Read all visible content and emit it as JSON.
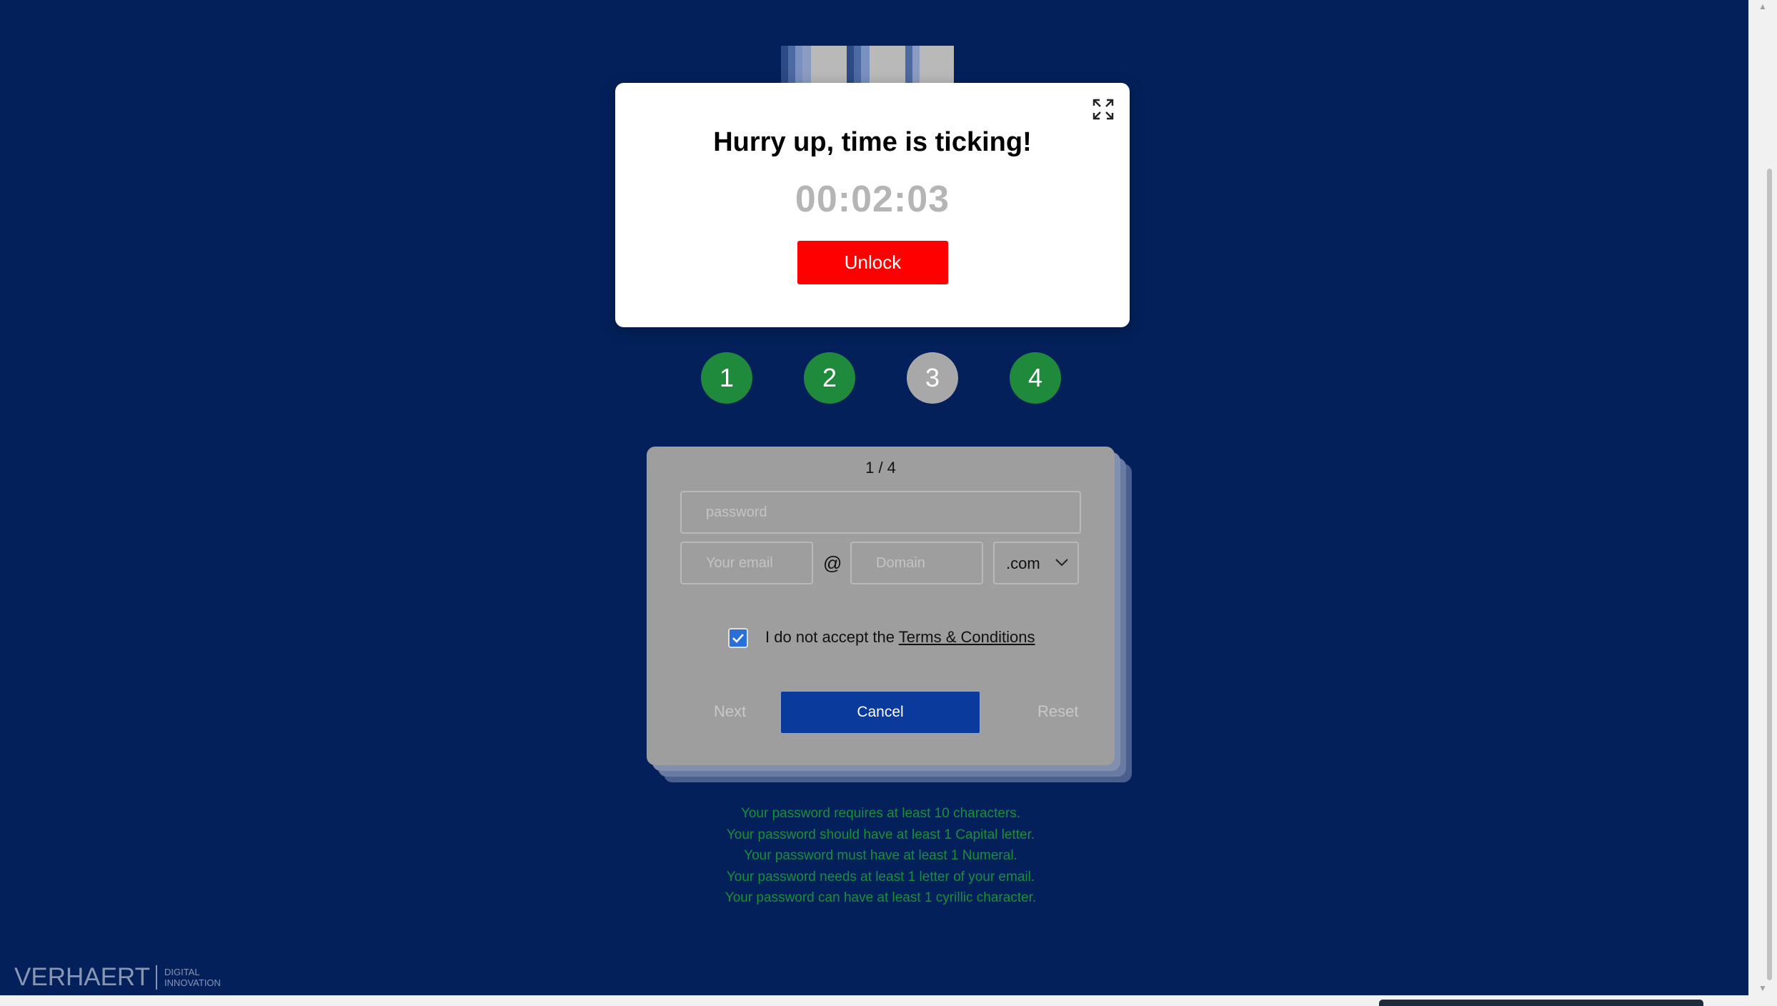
{
  "modal": {
    "title": "Hurry up, time is ticking!",
    "timer": "00:02:03",
    "unlock_label": "Unlock",
    "expand_icon": "expand-icon"
  },
  "steps": [
    {
      "label": "1",
      "color": "#1f8a3b"
    },
    {
      "label": "2",
      "color": "#1f8a3b"
    },
    {
      "label": "3",
      "color": "#a8a8a8"
    },
    {
      "label": "4",
      "color": "#1f8a3b"
    }
  ],
  "form": {
    "page_indicator": "1 / 4",
    "password_placeholder": "password",
    "email_placeholder": "Your email",
    "at_symbol": "@",
    "domain_placeholder": "Domain",
    "tld_selected": ".com",
    "checkbox_checked": true,
    "terms_prefix": "I do not accept the ",
    "terms_link": "Terms & Conditions",
    "next_label": "Next",
    "cancel_label": "Cancel",
    "reset_label": "Reset"
  },
  "requirements": [
    "Your password requires at least 10 characters.",
    "Your password should have at least 1 Capital letter.",
    "Your password must have at least 1 Numeral.",
    "Your password needs at least 1 letter of your email.",
    "Your password can have at least 1 cyrillic character."
  ],
  "logo": {
    "brand": "VERHAERT",
    "sub_line1": "DIGITAL",
    "sub_line2": "INNOVATION"
  },
  "colors": {
    "background": "#03205a",
    "unlock": "#ff0000",
    "cancel": "#0a3a9c",
    "requirement_text": "#1a8f3a",
    "step_done": "#1f8a3b",
    "step_pending": "#a8a8a8"
  }
}
